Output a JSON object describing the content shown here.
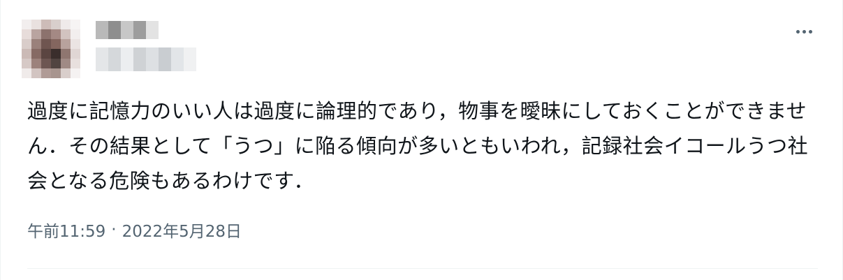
{
  "tweet": {
    "text": "過度に記憶力のいい人は過度に論理的であり，物事を曖昧にしておくことができません．その結果として「うつ」に陥る傾向が多いともいわれ，記録社会イコールうつ社会となる危険もあるわけです．",
    "time": "午前11:59",
    "separator": "·",
    "date": "2022年5月28日"
  },
  "icons": {
    "more": "more-horizontal-icon"
  },
  "colors": {
    "text": "#0f1419",
    "secondary": "#536471",
    "border": "#eff3f4"
  }
}
